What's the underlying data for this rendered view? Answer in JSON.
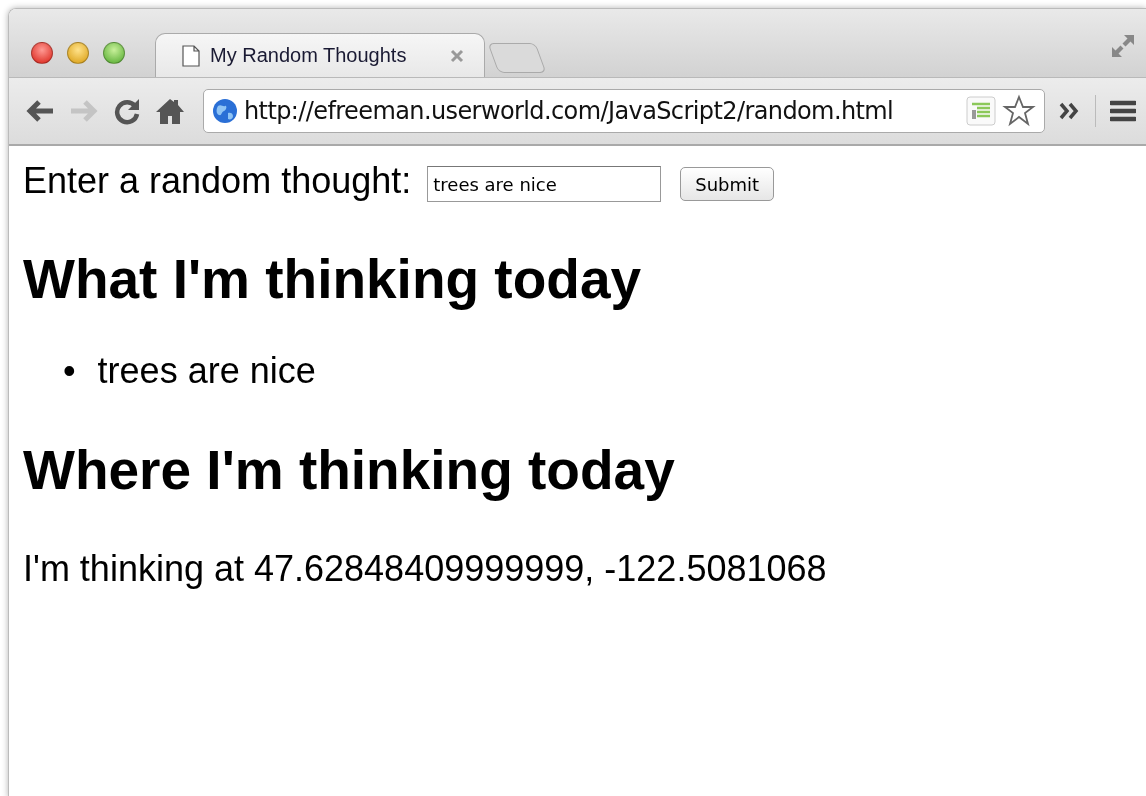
{
  "window": {
    "tabs": [
      {
        "title": "My Random Thoughts",
        "selected": true
      }
    ],
    "forward_button": {
      "disabled": true
    },
    "address": "http://efreeman.userworld.com/JavaScript2/random.html"
  },
  "page": {
    "form": {
      "label": "Enter a random thought:",
      "value": "trees are nice",
      "button": "Submit"
    },
    "sections": [
      {
        "heading": "What I'm thinking today",
        "kind": "list",
        "items": [
          {
            "bullet": "•",
            "text": "trees are nice"
          }
        ]
      },
      {
        "heading": "Where I'm thinking today",
        "kind": "paragraph",
        "text": "I'm thinking at 47.62848409999999, -122.5081068"
      }
    ]
  }
}
